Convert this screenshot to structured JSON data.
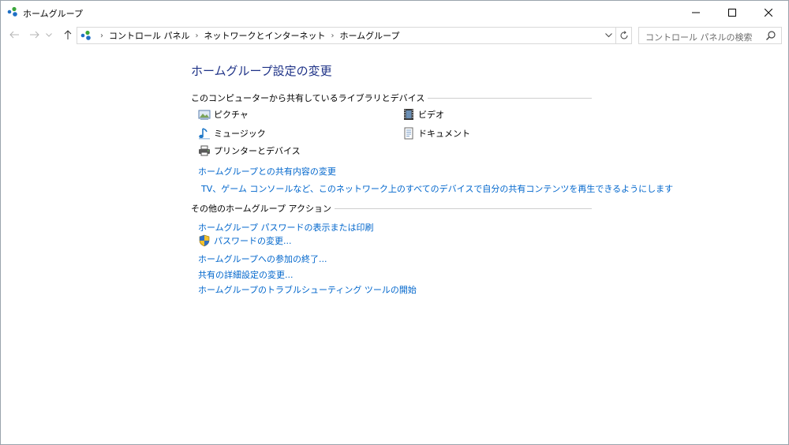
{
  "window": {
    "title": "ホームグループ"
  },
  "title_buttons": {
    "minimize": "—",
    "maximize": "☐",
    "close": "✕"
  },
  "address_bar": {
    "crumbs": [
      "コントロール パネル",
      "ネットワークとインターネット",
      "ホームグループ"
    ],
    "separator": "›"
  },
  "search": {
    "placeholder": "コントロール パネルの検索"
  },
  "main": {
    "page_title": "ホームグループ設定の変更",
    "shared_section": {
      "header": "このコンピューターから共有しているライブラリとデバイス",
      "items": {
        "pictures": "ピクチャ",
        "videos": "ビデオ",
        "music": "ミュージック",
        "documents": "ドキュメント",
        "printers": "プリンターとデバイス"
      },
      "links": {
        "change_shared": "ホームグループとの共有内容の変更",
        "allow_devices": "TV、ゲーム コンソールなど、このネットワーク上のすべてのデバイスで自分の共有コンテンツを再生できるようにします"
      }
    },
    "actions_section": {
      "header": "その他のホームグループ アクション",
      "links": {
        "view_password": "ホームグループ パスワードの表示または印刷",
        "change_password": "パスワードの変更...",
        "leave": "ホームグループへの参加の終了...",
        "advanced_sharing": "共有の詳細設定の変更...",
        "troubleshoot": "ホームグループのトラブルシューティング ツールの開始"
      }
    }
  },
  "colors": {
    "link": "#0066cc",
    "title": "#1e3287",
    "homegroup_blue": "#1f6fc5",
    "homegroup_green": "#3aa63a"
  }
}
